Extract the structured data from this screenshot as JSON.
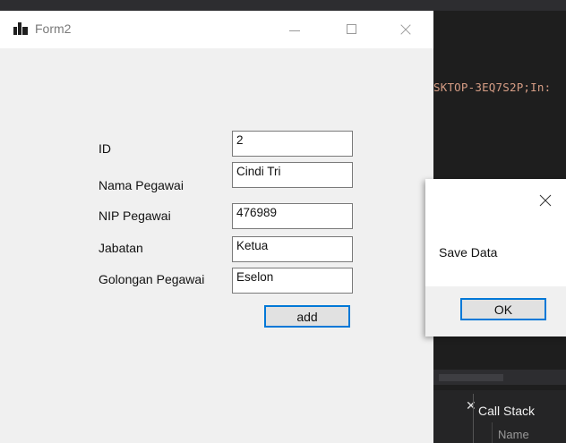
{
  "ide": {
    "code_fragment": "SKTOP-3EQ7S2P;In:",
    "panel_close": "✕",
    "call_stack_tab": "Call Stack",
    "name_column": "Name"
  },
  "form": {
    "title": "Form2",
    "fields": [
      {
        "label": "ID",
        "value": "2"
      },
      {
        "label": "Nama Pegawai",
        "value": "Cindi Tri"
      },
      {
        "label": "NIP Pegawai",
        "value": "476989"
      },
      {
        "label": "Jabatan",
        "value": "Ketua"
      },
      {
        "label": "Golongan Pegawai",
        "value": "Eselon"
      }
    ],
    "add_label": "add"
  },
  "message_box": {
    "text": "Save Data",
    "ok_label": "OK"
  },
  "colors": {
    "accent": "#0078d7",
    "ide_background": "#1e1e1e",
    "form_background": "#f0f0f0"
  }
}
